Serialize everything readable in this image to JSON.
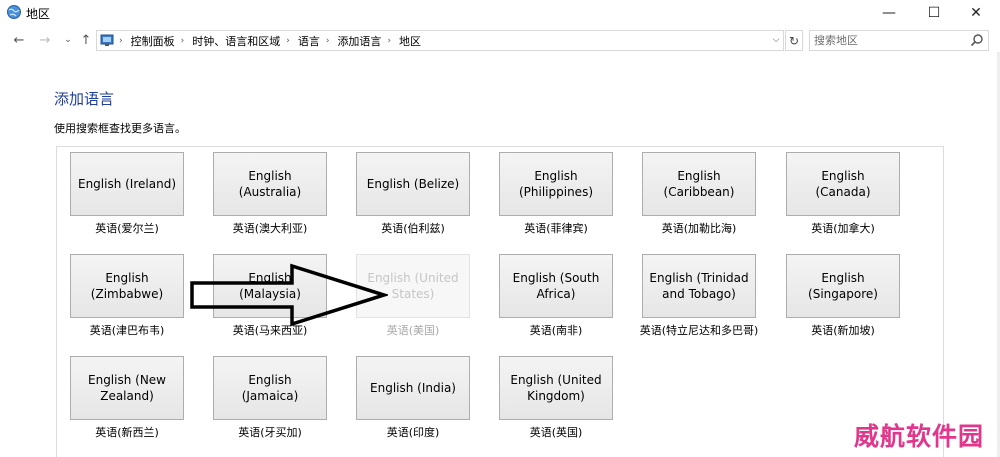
{
  "window": {
    "title": "地区",
    "controls": {
      "minimize": "—",
      "maximize": "☐",
      "close": "✕"
    }
  },
  "navigation": {
    "back": "←",
    "forward": "→",
    "recent": "⌄",
    "up": "↑",
    "breadcrumbs": [
      "控制面板",
      "时钟、语言和区域",
      "语言",
      "添加语言",
      "地区"
    ],
    "separator": "›",
    "dropdown": "⌵",
    "refresh": "↻"
  },
  "search": {
    "placeholder": "搜索地区"
  },
  "page": {
    "title": "添加语言",
    "description": "使用搜索框查找更多语言。"
  },
  "languages": [
    {
      "label": "English (Ireland)",
      "caption": "英语(爱尔兰)",
      "disabled": false
    },
    {
      "label": "English (Australia)",
      "caption": "英语(澳大利亚)",
      "disabled": false
    },
    {
      "label": "English (Belize)",
      "caption": "英语(伯利兹)",
      "disabled": false
    },
    {
      "label": "English (Philippines)",
      "caption": "英语(菲律宾)",
      "disabled": false
    },
    {
      "label": "English (Caribbean)",
      "caption": "英语(加勒比海)",
      "disabled": false
    },
    {
      "label": "English (Canada)",
      "caption": "英语(加拿大)",
      "disabled": false
    },
    {
      "label": "English (Zimbabwe)",
      "caption": "英语(津巴布韦)",
      "disabled": false
    },
    {
      "label": "English (Malaysia)",
      "caption": "英语(马来西亚)",
      "disabled": false
    },
    {
      "label": "English (United States)",
      "caption": "英语(美国)",
      "disabled": true
    },
    {
      "label": "English (South Africa)",
      "caption": "英语(南非)",
      "disabled": false
    },
    {
      "label": "English (Trinidad and Tobago)",
      "caption": "英语(特立尼达和多巴哥)",
      "disabled": false
    },
    {
      "label": "English (Singapore)",
      "caption": "英语(新加坡)",
      "disabled": false
    },
    {
      "label": "English (New Zealand)",
      "caption": "英语(新西兰)",
      "disabled": false
    },
    {
      "label": "English (Jamaica)",
      "caption": "英语(牙买加)",
      "disabled": false
    },
    {
      "label": "English (India)",
      "caption": "英语(印度)",
      "disabled": false
    },
    {
      "label": "English (United Kingdom)",
      "caption": "英语(英国)",
      "disabled": false
    }
  ],
  "watermark": "威航软件园",
  "colors": {
    "title_blue": "#1e3f9c",
    "watermark_pink": "#e0368c",
    "tile_border": "#adadad",
    "disabled_text": "#c6c6c6"
  }
}
